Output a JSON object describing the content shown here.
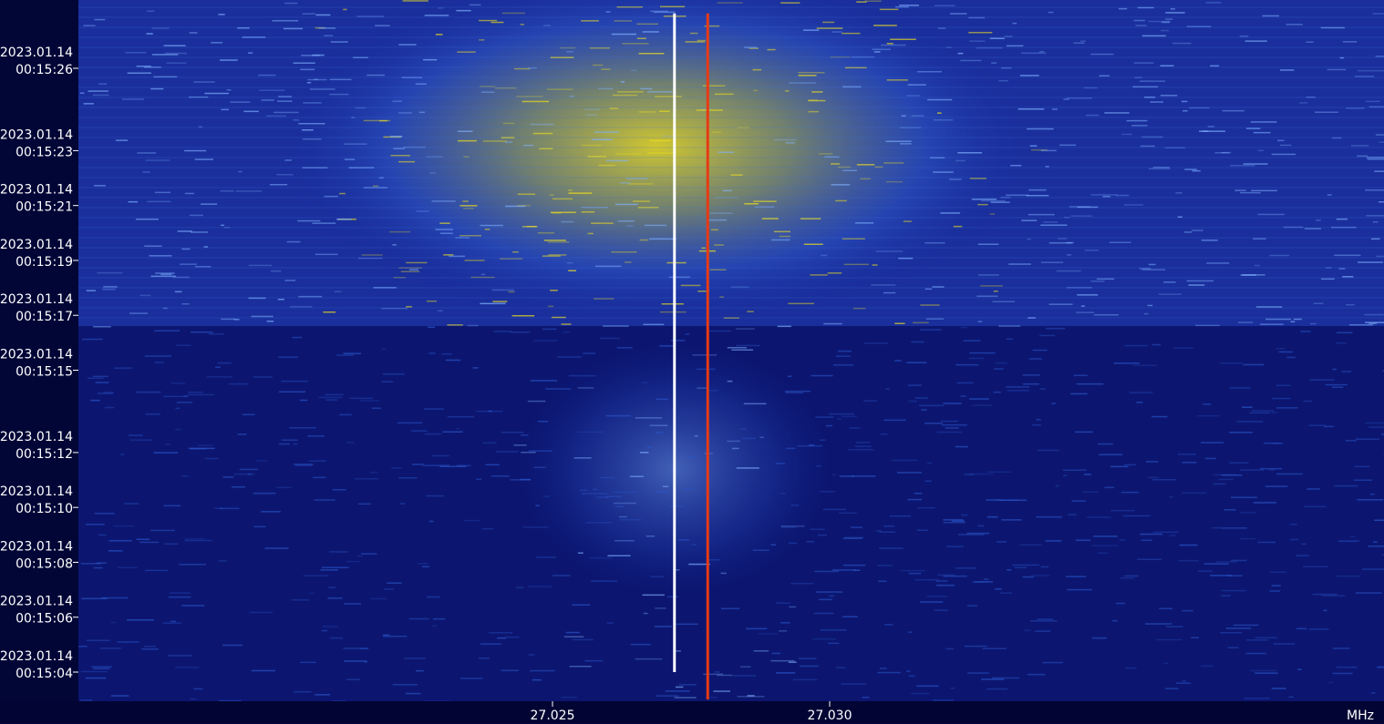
{
  "chart_data": {
    "type": "heatmap",
    "title": "",
    "xlabel": "",
    "ylabel": "",
    "x_unit": "MHz",
    "x_ticks": [
      {
        "value": 27.025,
        "label": "27.025"
      },
      {
        "value": 27.03,
        "label": "27.030"
      }
    ],
    "y_ticks": [
      {
        "date": "2023.01.14",
        "time": "00:15:26"
      },
      {
        "date": "2023.01.14",
        "time": "00:15:23"
      },
      {
        "date": "2023.01.14",
        "time": "00:15:21"
      },
      {
        "date": "2023.01.14",
        "time": "00:15:19"
      },
      {
        "date": "2023.01.14",
        "time": "00:15:17"
      },
      {
        "date": "2023.01.14",
        "time": "00:15:15"
      },
      {
        "date": "2023.01.14",
        "time": "00:15:12"
      },
      {
        "date": "2023.01.14",
        "time": "00:15:10"
      },
      {
        "date": "2023.01.14",
        "time": "00:15:08"
      },
      {
        "date": "2023.01.14",
        "time": "00:15:06"
      },
      {
        "date": "2023.01.14",
        "time": "00:15:04"
      }
    ],
    "colormap": [
      "#020633",
      "#0a1a8c",
      "#2a55c8",
      "#7fb0ff",
      "#f2e21a",
      "#f5a000",
      "#e02a10",
      "#ffffff"
    ],
    "carriers": [
      {
        "freq_mhz": 27.0272,
        "color": "#ffffff",
        "start": "00:15:04",
        "end": "00:15:28"
      },
      {
        "freq_mhz": 27.0278,
        "color": "#e83a14",
        "start": "00:15:03",
        "end": "00:15:28"
      }
    ]
  }
}
